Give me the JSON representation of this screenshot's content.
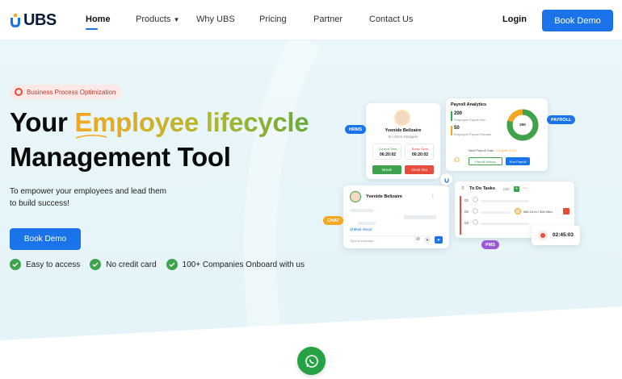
{
  "brand": {
    "name": "UBS",
    "primary": "#1a73e8"
  },
  "nav": {
    "items": [
      {
        "label": "Home",
        "active": true
      },
      {
        "label": "Products"
      },
      {
        "label": "Why UBS"
      },
      {
        "label": "Pricing"
      },
      {
        "label": "Partner"
      },
      {
        "label": "Contact Us"
      }
    ],
    "login": "Login",
    "book_demo": "Book Demo"
  },
  "hero": {
    "chip": "Business Process Optimization",
    "headline_part1": "Your ",
    "headline_highlight": "Employee lifecycle",
    "headline_line2": "Management Tool",
    "subtitle": "To empower your employees and lead them to build success!",
    "cta": "Book Demo",
    "benefits": [
      "Easy to access",
      "No credit card",
      "100+ Companies Onboard with us"
    ]
  },
  "mock": {
    "hrms": {
      "tag": "HRMS",
      "name": "Yvenide Belizaire",
      "role": "Sr UI/UX Designer",
      "current_time_label": "Current Time",
      "current_time": "06:20:02",
      "break_time_label": "Break Time",
      "break_time": "00:20:02",
      "break_btn": "Break",
      "clockout_btn": "Clock Out"
    },
    "payroll": {
      "tag": "PAYROLL",
      "title": "Payroll Analytics",
      "run_count": "200",
      "run_label": "Employee Payroll Run",
      "remain_count": "50",
      "remain_label": "Employee Payroll Remain",
      "donut_value": "200",
      "next_date_label": "Next Payroll Date :",
      "next_date": "25 April, 2023",
      "history_btn": "Payroll History",
      "run_btn": "Run Payroll"
    },
    "chat": {
      "tag": "CHAT",
      "name": "Yvenide Belizaire",
      "mention": "@Mark Wood",
      "placeholder": "Type a message..."
    },
    "pms": {
      "tag": "PMS",
      "title": "To Do Tasks",
      "count": "(05)",
      "rows": [
        "01",
        "02",
        "03"
      ],
      "duration": "06h 14 m / 30h 00m"
    },
    "timer": "02:45:03"
  },
  "whatsapp_icon": "whatsapp-icon"
}
